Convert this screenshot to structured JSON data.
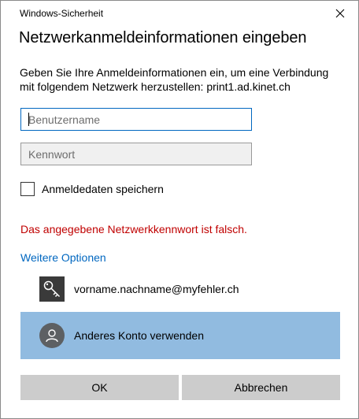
{
  "window": {
    "title": "Windows-Sicherheit"
  },
  "dialog": {
    "heading": "Netzwerkanmeldeinformationen eingeben",
    "description": "Geben Sie Ihre Anmeldeinformationen ein, um eine Verbindung mit folgendem Netzwerk herzustellen: print1.ad.kinet.ch",
    "username": {
      "value": "",
      "placeholder": "Benutzername"
    },
    "password": {
      "value": "",
      "placeholder": "Kennwort"
    },
    "remember": {
      "label": "Anmeldedaten speichern",
      "checked": false
    },
    "error": "Das angegebene Netzwerkkennwort ist falsch.",
    "more_options": "Weitere Optionen",
    "accounts": [
      {
        "label": "vorname.nachname@myfehler.ch",
        "icon": "key-icon"
      },
      {
        "label": "Anderes Konto verwenden",
        "icon": "user-icon",
        "selected": true
      }
    ],
    "buttons": {
      "ok": "OK",
      "cancel": "Abbrechen"
    }
  },
  "colors": {
    "accent": "#0067c0",
    "error": "#c00000",
    "selected_row": "#91bbe0",
    "button_bg": "#cccccc"
  }
}
